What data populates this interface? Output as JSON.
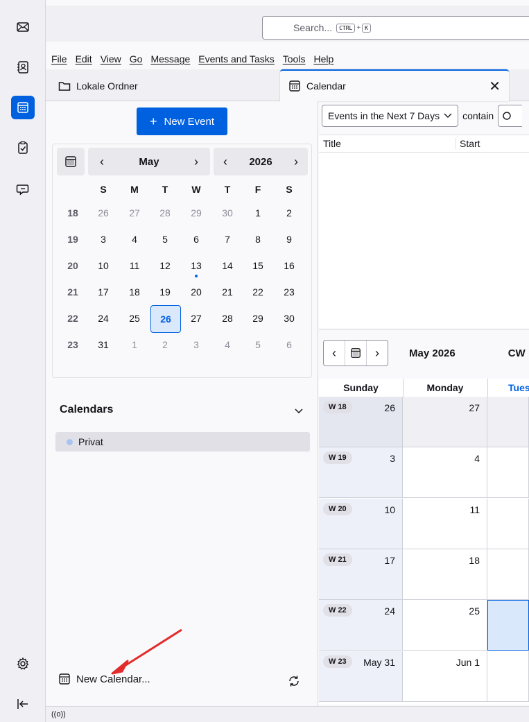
{
  "search": {
    "placeholder": "Search...",
    "key1": "CTRL",
    "plus": "+",
    "key2": "K"
  },
  "menu": [
    "File",
    "Edit",
    "View",
    "Go",
    "Message",
    "Events and Tasks",
    "Tools",
    "Help"
  ],
  "tabs": {
    "folders": "Lokale Ordner",
    "calendar": "Calendar",
    "close": "✕"
  },
  "left": {
    "new_event": "New Event",
    "new_event_plus": "+",
    "month": "May",
    "year": "2026",
    "dows": [
      "S",
      "M",
      "T",
      "W",
      "T",
      "F",
      "S"
    ],
    "weeks": [
      {
        "wk": "18",
        "days": [
          "26",
          "27",
          "28",
          "29",
          "30",
          "1",
          "2"
        ]
      },
      {
        "wk": "19",
        "days": [
          "3",
          "4",
          "5",
          "6",
          "7",
          "8",
          "9"
        ]
      },
      {
        "wk": "20",
        "days": [
          "10",
          "11",
          "12",
          "13",
          "14",
          "15",
          "16"
        ]
      },
      {
        "wk": "21",
        "days": [
          "17",
          "18",
          "19",
          "20",
          "21",
          "22",
          "23"
        ]
      },
      {
        "wk": "22",
        "days": [
          "24",
          "25",
          "26",
          "27",
          "28",
          "29",
          "30"
        ]
      },
      {
        "wk": "23",
        "days": [
          "31",
          "1",
          "2",
          "3",
          "4",
          "5",
          "6"
        ]
      }
    ],
    "calendars_title": "Calendars",
    "calendar_item": "Privat",
    "new_calendar": "New Calendar..."
  },
  "right": {
    "filter": "Events in the Next 7 Days",
    "contain": "contain",
    "col_title": "Title",
    "col_start": "Start",
    "month_label": "May 2026",
    "cw": "CW",
    "day_headers": [
      "Sunday",
      "Monday",
      "Tues"
    ],
    "rows": [
      {
        "wk": "W 18",
        "d": [
          "26",
          "27"
        ]
      },
      {
        "wk": "W 19",
        "d": [
          "3",
          "4"
        ]
      },
      {
        "wk": "W 20",
        "d": [
          "10",
          "11"
        ]
      },
      {
        "wk": "W 21",
        "d": [
          "17",
          "18"
        ]
      },
      {
        "wk": "W 22",
        "d": [
          "24",
          "25"
        ]
      },
      {
        "wk": "W 23",
        "d": [
          "May 31",
          "Jun 1"
        ]
      }
    ]
  },
  "status": {
    "icon_text": "((o))"
  },
  "colors": {
    "accent": "#0061e0",
    "today_bg": "#d9e8fb",
    "arrow": "#e22c2c"
  }
}
